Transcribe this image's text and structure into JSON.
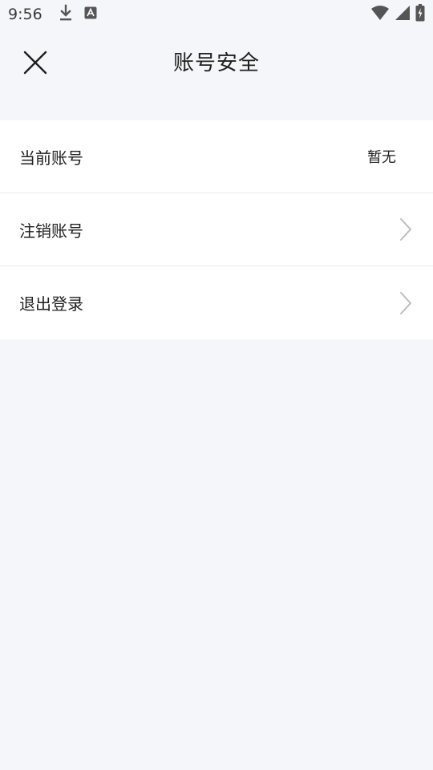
{
  "status_bar": {
    "time": "9:56",
    "icons_left": [
      "download-icon",
      "text-a-icon"
    ],
    "icons_right": [
      "wifi-icon",
      "cellular-signal-icon",
      "battery-charging-icon"
    ]
  },
  "header": {
    "title": "账号安全",
    "close_icon": "close-icon"
  },
  "account_rows": [
    {
      "label": "当前账号",
      "value": "暂无"
    },
    {
      "label": "注销账号",
      "icon": "chevron-right-icon"
    },
    {
      "label": "退出登录",
      "icon": "chevron-right-icon"
    }
  ],
  "colors": {
    "background": "#f5f6fa",
    "card": "#ffffff",
    "text": "#1f1f1f",
    "chevron": "#bdbdbd"
  }
}
